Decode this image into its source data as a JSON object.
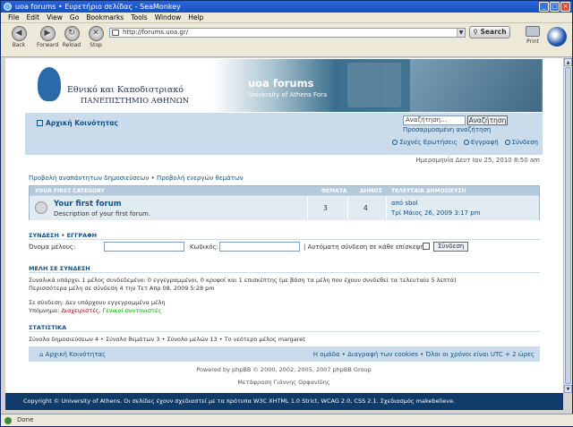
{
  "window": {
    "title": "uoa forums • Ευρετήριο σελίδας - SeaMonkey"
  },
  "menu": [
    "File",
    "Edit",
    "View",
    "Go",
    "Bookmarks",
    "Tools",
    "Window",
    "Help"
  ],
  "toolbar": {
    "back": "Back",
    "forward": "Forward",
    "reload": "Reload",
    "stop": "Stop",
    "url": "http://forums.uoa.gr/",
    "search": "Search",
    "print": "Print"
  },
  "banner": {
    "univ_line1": "Εθνικό και Καποδιστριακό",
    "univ_line2": "ΠΑΝΕΠΙΣΤΗΜΙΟ ΑΘΗΝΩΝ",
    "forum_name": "uoa forums",
    "forum_sub": "University of Athens Fora"
  },
  "header": {
    "home": "Αρχική Κοινότητας",
    "search_placeholder": "Αναζήτηση…",
    "search_button": "Αναζήτηση",
    "advanced_search": "Προσαρμοσμένη αναζήτηση",
    "faq": "Συχνές Ερωτήσεις",
    "register": "Εγγραφή",
    "login": "Σύνδεση"
  },
  "date_line": "Ημερομηνία Δευτ Ιαν 25, 2010 8:50 am",
  "view_links": "Προβολή αναπάντητων δημοσιεύσεων • Προβολή ενεργών θεμάτων",
  "forum_table": {
    "category": "YOUR FIRST CATEGORY",
    "col_topics": "ΘΕΜΑΤΑ",
    "col_posts": "ΔΗΜΟΣ",
    "col_last": "ΤΕΛΕΥΤΑΙΑ ΔΗΜΟΣΙΕΥΣΗ",
    "rows": [
      {
        "title": "Your first forum",
        "desc": "Description of your first forum.",
        "topics": "3",
        "posts": "4",
        "last_by": "από sbol",
        "last_date": "Τρί Μάιος 26, 2009 3:17 pm"
      }
    ]
  },
  "login_section": {
    "title": "ΣΥΝΔΕΣΗ • ΕΓΓΡΑΦΗ",
    "username_label": "Όνομα μέλους:",
    "password_label": "Κωδικός:",
    "remember_label": "| Αυτόματη σύνδεση σε κάθε επίσκεψη",
    "submit": "Σύνδεση"
  },
  "online": {
    "title": "ΜΕΛΗ ΣΕ ΣΥΝΔΕΣΗ",
    "line1": "Συνολικά υπάρχει 1 μέλος συνδεδεμένο: 0 εγγεγραμμένοι, 0 κρυφοί και 1 επισκέπτης (με βάση τα μέλη που έχουν συνδεθεί τα τελευταία 5 λεπτά)",
    "line2": "Περισσότερα μέλη σε σύνδεση 4 την Τετ Απρ 08, 2009 5:28 pm",
    "line3": "Σε σύνδεση: Δεν υπάρχουν εγγεγραμμένα μέλη",
    "legend_label": "Υπόμνημα:",
    "legend_admin": "Διαχειριστές",
    "legend_mod": "Γενικοί συντονιστές"
  },
  "stats": {
    "title": "ΣΤΑΤΙΣΤΙΚΑ",
    "line": "Σύνολο δημοσιεύσεων 4 • Σύνολο θεμάτων 3 • Σύνολο μελών 13 • Το νεότερο μέλος margaret"
  },
  "footer_nav": {
    "home": "Αρχική Κοινότητας",
    "right": "Η ομάδα • Διαγραφή των cookies • Όλοι οι χρόνοι είναι UTC + 2 ώρες"
  },
  "powered": "Powered by phpBB © 2000, 2002, 2005, 2007 phpBB Group",
  "translation": "Μετάφραση Γιάννης Ορφανίδης",
  "page_footer": "Copyright © University of Athens. Οι σελίδες έχουν σχεδιαστεί με τα πρότυπα W3C XHTML 1.0 Strict, WCAG 2.0, CSS 2.1. Σχεδιασμός makebelieve.",
  "status": "Done"
}
